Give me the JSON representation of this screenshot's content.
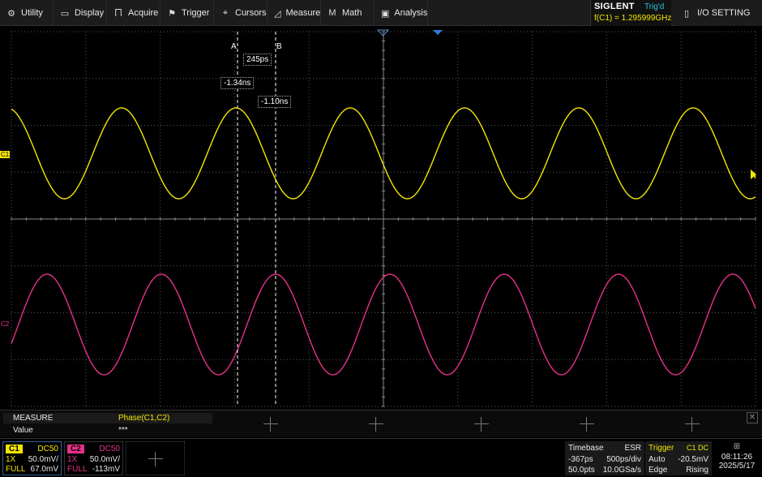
{
  "menu": {
    "items": [
      {
        "name": "utility",
        "label": "Utility",
        "icon": "gear-icon"
      },
      {
        "name": "display",
        "label": "Display",
        "icon": "monitor-icon"
      },
      {
        "name": "acquire",
        "label": "Acquire",
        "icon": "waveform-icon"
      },
      {
        "name": "trigger",
        "label": "Trigger",
        "icon": "flag-icon"
      },
      {
        "name": "cursors",
        "label": "Cursors",
        "icon": "crosshair-icon"
      },
      {
        "name": "measure",
        "label": "Measure",
        "icon": "ruler-icon"
      },
      {
        "name": "math",
        "label": "Math",
        "icon": "math-icon"
      },
      {
        "name": "analysis",
        "label": "Analysis",
        "icon": "analysis-icon"
      }
    ],
    "brand": "SIGLENT",
    "trigger_status": "Trig'd",
    "frequency": "f(C1) = 1.295999GHz",
    "io_setting": "I/O SETTING"
  },
  "cursors": {
    "a_label": "A",
    "b_label": "B",
    "delta": "245ps",
    "a_time": "-1.34ns",
    "b_time": "-1.10ns"
  },
  "channels_markers": {
    "c1": "C1",
    "c2": "C2"
  },
  "measure": {
    "title": "MEASURE",
    "parameter": "Phase(C1,C2)",
    "value_label": "Value",
    "value": "***",
    "close": "✕"
  },
  "status": {
    "c1": {
      "name": "C1",
      "coupling": "DC50",
      "probe": "1X",
      "scale": "50.0mV/",
      "bw": "FULL",
      "offset": "67.0mV",
      "color": "#f5e600"
    },
    "c2": {
      "name": "C2",
      "coupling": "DC50",
      "probe": "1X",
      "scale": "50.0mV/",
      "bw": "FULL",
      "offset": "-113mV",
      "color": "#e8318a"
    },
    "timebase": {
      "title": "Timebase",
      "mode": "ESR",
      "delay": "-367ps",
      "scale": "500ps/div",
      "points": "50.0pts",
      "rate": "10.0GSa/s"
    },
    "trigger": {
      "title": "Trigger",
      "source": "C1 DC",
      "mode": "Auto",
      "level": "-20.5mV",
      "type": "Edge",
      "slope": "Rising"
    },
    "clock": {
      "time": "08:11:26",
      "date": "2025/5/17"
    }
  },
  "colors": {
    "ch1": "#f5e600",
    "ch2": "#e8318a",
    "grid": "#555555",
    "cursor": "#ffffff"
  }
}
